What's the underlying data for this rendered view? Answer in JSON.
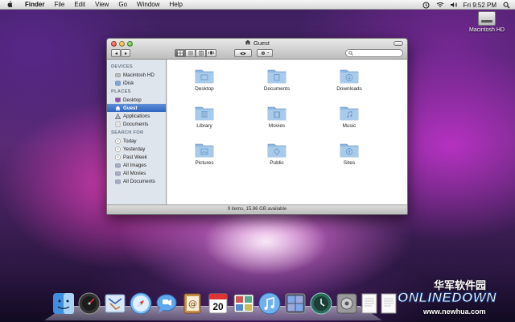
{
  "menubar": {
    "app": "Finder",
    "items": [
      "File",
      "Edit",
      "View",
      "Go",
      "Window",
      "Help"
    ],
    "clock": "Fri 9:52 PM"
  },
  "desktop": {
    "hd_label": "Macintosh HD"
  },
  "window": {
    "title": "Guest",
    "status": "9 items, 15.86 GB available",
    "sidebar": {
      "devices_header": "DEVICES",
      "devices": [
        "Macintosh HD",
        "iDisk"
      ],
      "places_header": "PLACES",
      "places": [
        "Desktop",
        "Guest",
        "Applications",
        "Documents"
      ],
      "selected": "Guest",
      "search_header": "SEARCH FOR",
      "search": [
        "Today",
        "Yesterday",
        "Past Week",
        "All Images",
        "All Movies",
        "All Documents"
      ]
    },
    "folders": [
      "Desktop",
      "Documents",
      "Downloads",
      "Library",
      "Movies",
      "Music",
      "Pictures",
      "Public",
      "Sites"
    ]
  },
  "dock": {
    "items": [
      "Finder",
      "Dashboard",
      "Mail",
      "Safari",
      "iChat",
      "Address Book",
      "iCal",
      "Photo Booth",
      "iTunes",
      "Spaces",
      "Time Machine",
      "System Preferences",
      "Document",
      "Document"
    ],
    "ical_date": "20"
  },
  "watermark": {
    "cn": "华军软件园",
    "logo": "ONLINEDOWN",
    "url": "www.newhua.com"
  }
}
